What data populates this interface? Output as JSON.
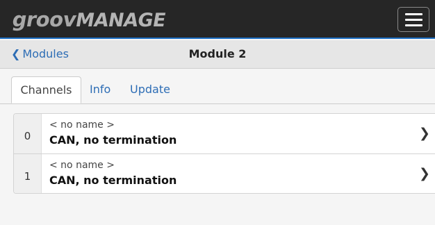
{
  "header": {
    "logo_part1": "groov",
    "logo_part2": "MANAGE",
    "menu_icon": "hamburger-menu-icon"
  },
  "subheader": {
    "back_icon": "chevron-left-icon",
    "back_label": "Modules",
    "title": "Module 2"
  },
  "tabs": [
    {
      "label": "Channels",
      "active": true
    },
    {
      "label": "Info",
      "active": false
    },
    {
      "label": "Update",
      "active": false
    }
  ],
  "channels": [
    {
      "number": "0",
      "name": "< no name >",
      "type": "CAN, no termination"
    },
    {
      "number": "1",
      "name": "< no name >",
      "type": "CAN, no termination"
    }
  ],
  "colors": {
    "header_bg": "#262626",
    "accent_blue": "#2d6db5",
    "subheader_bg": "#e6e6e6",
    "page_bg": "#f5f5f5"
  }
}
